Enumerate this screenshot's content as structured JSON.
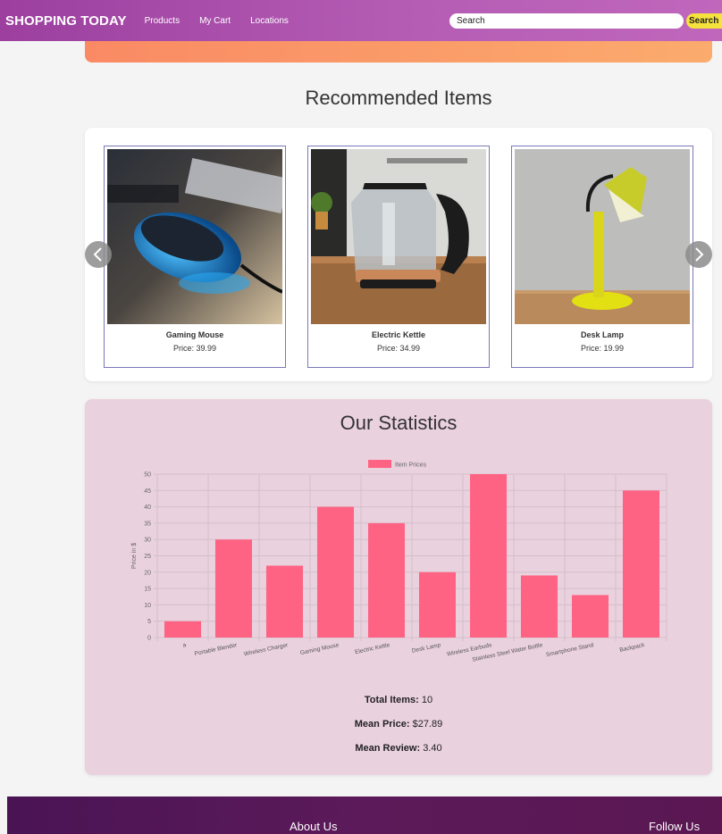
{
  "nav": {
    "brand": "SHOPPING TODAY",
    "links": [
      "Products",
      "My Cart",
      "Locations"
    ],
    "search_placeholder": "Search",
    "search_button": "Search"
  },
  "recommended": {
    "title": "Recommended Items",
    "items": [
      {
        "name": "Gaming Mouse",
        "price": "Price: 39.99"
      },
      {
        "name": "Electric Kettle",
        "price": "Price: 34.99"
      },
      {
        "name": "Desk Lamp",
        "price": "Price: 19.99"
      }
    ]
  },
  "statistics": {
    "title": "Our Statistics",
    "total_items_label": "Total Items:",
    "total_items_value": "10",
    "mean_price_label": "Mean Price:",
    "mean_price_value": "$27.89",
    "mean_review_label": "Mean Review:",
    "mean_review_value": "3.40"
  },
  "chart_data": {
    "type": "bar",
    "categories": [
      "a",
      "Portable Blender",
      "Wireless Charger",
      "Gaming Mouse",
      "Electric Kettle",
      "Desk Lamp",
      "Wireless Earbuds",
      "Stainless Steel Water Bottle",
      "Smartphone Stand",
      "Backpack"
    ],
    "series": [
      {
        "name": "Item Prices",
        "values": [
          5,
          30,
          22,
          40,
          35,
          20,
          50,
          19,
          13,
          45
        ]
      }
    ],
    "ylabel": "Price in $",
    "xlabel": "",
    "ylim": [
      0,
      50
    ],
    "yticks": [
      0,
      5,
      10,
      15,
      20,
      25,
      30,
      35,
      40,
      45,
      50
    ],
    "grid": true,
    "legend": "top-center",
    "bar_color": "#ff6384"
  },
  "footer": {
    "about": "About Us",
    "follow": "Follow Us"
  }
}
